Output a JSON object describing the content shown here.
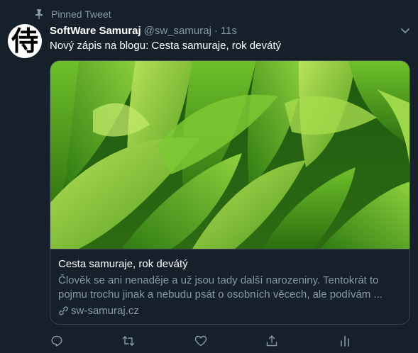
{
  "pinned": {
    "label": "Pinned Tweet"
  },
  "author": {
    "avatar_glyph": "侍",
    "display_name": "SoftWare Samuraj",
    "handle": "@sw_samuraj",
    "separator": "·",
    "time": "11s"
  },
  "tweet": {
    "text": "Nový zápis na blogu: Cesta samuraje, rok devátý"
  },
  "card": {
    "title": "Cesta samuraje, rok devátý",
    "description": "Člověk se ani nenaděje a už jsou tady další narozeniny. Tentokrát to pojmu trochu jinak a nebudu psát o osobních věcech, ale podívám ...",
    "domain": "sw-samuraj.cz"
  },
  "actions": [
    "reply-icon",
    "retweet-icon",
    "like-icon",
    "share-icon",
    "analytics-icon"
  ],
  "colors": {
    "background": "#15202b",
    "secondary_text": "#8899a6",
    "border": "#38444d"
  }
}
